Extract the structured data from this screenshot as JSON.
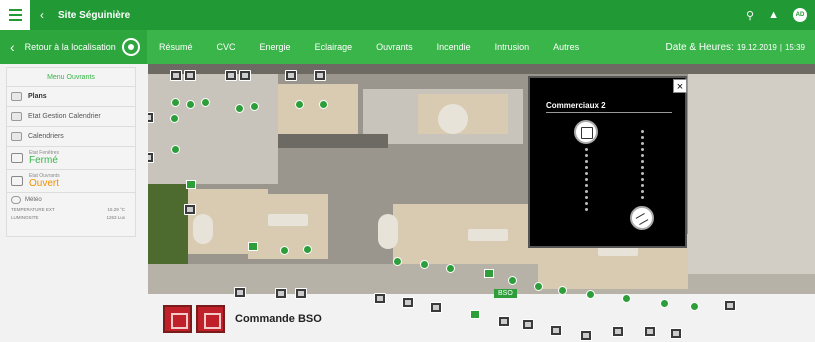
{
  "topbar": {
    "site_name": "Site Séguinière",
    "back_icon": "chevron-left",
    "avatar_initials": "AD",
    "icons": [
      "menu-icon",
      "search-icon",
      "bell-icon",
      "user-avatar"
    ]
  },
  "navbar": {
    "back_label": "Retour à la localisation",
    "tabs": [
      {
        "label": "Résumé"
      },
      {
        "label": "CVC"
      },
      {
        "label": "Energie"
      },
      {
        "label": "Eclairage"
      },
      {
        "label": "Ouvrants"
      },
      {
        "label": "Incendie"
      },
      {
        "label": "Intrusion"
      },
      {
        "label": "Autres"
      }
    ],
    "datetime_label": "Date & Heures:",
    "date": "19.12.2019",
    "time": "15:39"
  },
  "sidebar": {
    "header": "Menu Ouvrants",
    "items": [
      {
        "label": "Plans",
        "bold": true
      },
      {
        "label": "Etat Gestion Calendrier",
        "bold": false
      },
      {
        "label": "Calendriers",
        "bold": false
      }
    ],
    "etat_fenetres": {
      "label": "Etat Fenêtres",
      "value": "Fermé",
      "color": "#3ab54a"
    },
    "etat_ouvrants": {
      "label": "Etat Ouvrants",
      "value": "Ouvert",
      "color": "#f29100"
    },
    "meteo": {
      "title": "Météo",
      "rows": [
        {
          "label": "TEMPERATURE EXT",
          "value": "15.29 °C"
        },
        {
          "label": "LUMINOSITE",
          "value": "1263 Lux"
        }
      ]
    }
  },
  "popup": {
    "title": "Commerciaux 2",
    "close": "×"
  },
  "bso_label": "BSO",
  "commande": {
    "label": "Commande BSO"
  },
  "colors": {
    "primary_dark": "#219a36",
    "primary": "#3ab54a",
    "orange": "#f29100"
  }
}
